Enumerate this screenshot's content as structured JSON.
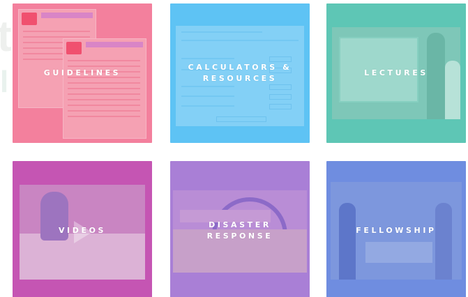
{
  "tiles": {
    "guidelines": {
      "label": "GUIDELINES",
      "color": "#f3809d"
    },
    "calculators": {
      "label_line1": "CALCULATORS &",
      "label_line2": "RESOURCES",
      "color": "#5ec3f4"
    },
    "lectures": {
      "label": "LECTURES",
      "color": "#5ec6b5"
    },
    "videos": {
      "label": "VIDEOS",
      "color": "#c555b3"
    },
    "disaster": {
      "label": "DISASTER RESPONSE",
      "color": "#a97fd6"
    },
    "fellowship": {
      "label": "FELLOWSHIP",
      "color": "#6f8de0"
    }
  }
}
